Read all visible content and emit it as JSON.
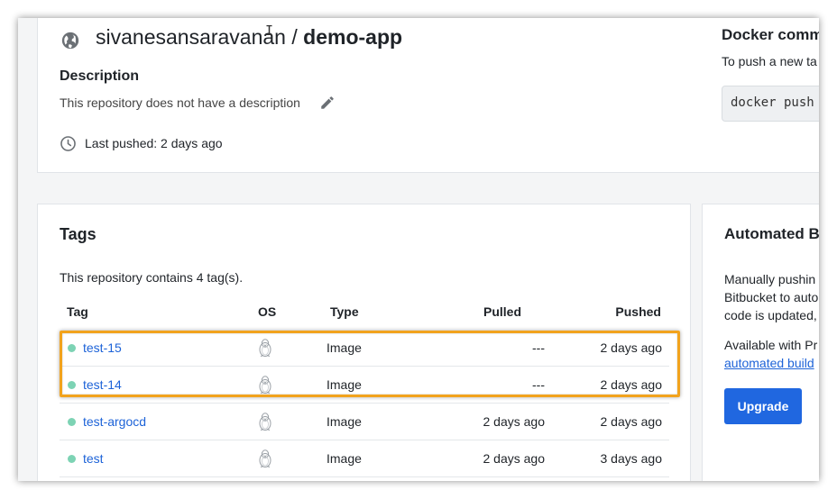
{
  "repo": {
    "namespace": "sivanesansaravanan",
    "separator": "/",
    "name": "demo-app",
    "description_heading": "Description",
    "description_text": "This repository does not have a description",
    "last_pushed": "Last pushed: 2 days ago"
  },
  "docker_command": {
    "heading": "Docker comm",
    "subtext": "To push a new ta",
    "code": "docker push"
  },
  "tags": {
    "heading": "Tags",
    "count_text": "This repository contains 4 tag(s).",
    "columns": {
      "tag": "Tag",
      "os": "OS",
      "type": "Type",
      "pulled": "Pulled",
      "pushed": "Pushed"
    },
    "rows": [
      {
        "tag": "test-15",
        "type": "Image",
        "pulled": "---",
        "pushed": "2 days ago"
      },
      {
        "tag": "test-14",
        "type": "Image",
        "pulled": "---",
        "pushed": "2 days ago"
      },
      {
        "tag": "test-argocd",
        "type": "Image",
        "pulled": "2 days ago",
        "pushed": "2 days ago"
      },
      {
        "tag": "test",
        "type": "Image",
        "pulled": "2 days ago",
        "pushed": "3 days ago"
      }
    ]
  },
  "automated_builds": {
    "heading": "Automated B",
    "line1": "Manually pushin",
    "line2": "Bitbucket to auto",
    "line3": "code is updated,",
    "available": "Available with Pr",
    "link": "automated build",
    "upgrade_button": "Upgrade"
  },
  "icons": {
    "globe": "globe-icon",
    "edit": "pencil-icon",
    "clock": "clock-icon",
    "os": "linux-penguin-icon"
  },
  "colors": {
    "link": "#1d63d8",
    "status_dot": "#7dd3b4",
    "highlight_border": "#f2a31d",
    "primary_button": "#2067e0"
  }
}
